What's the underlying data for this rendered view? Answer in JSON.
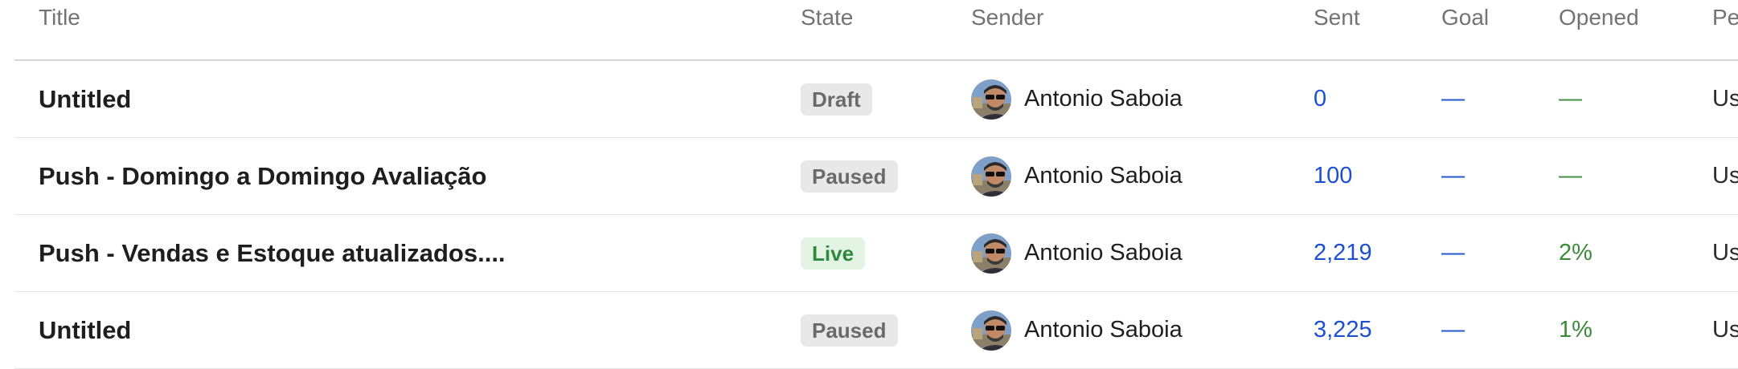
{
  "columns": {
    "title": "Title",
    "state": "State",
    "sender": "Sender",
    "sent": "Sent",
    "goal": "Goal",
    "opened": "Opened",
    "per": "Pe"
  },
  "colors": {
    "sent": "#1f4fd1",
    "opened": "#3a8a3a",
    "live_badge_bg": "#e3f4e5",
    "paused_badge_bg": "#e8e8e8"
  },
  "rows": [
    {
      "title": "Untitled",
      "state": "Draft",
      "state_kind": "draft",
      "sender": "Antonio Saboia",
      "sender_avatar": "avatar-photo-icon",
      "sent": "0",
      "goal": "—",
      "opened": "—",
      "per": "Us"
    },
    {
      "title": "Push - Domingo a Domingo Avaliação",
      "state": "Paused",
      "state_kind": "paused",
      "sender": "Antonio Saboia",
      "sender_avatar": "avatar-photo-icon",
      "sent": "100",
      "goal": "—",
      "opened": "—",
      "per": "Us"
    },
    {
      "title": "Push - Vendas e Estoque atualizados....",
      "state": "Live",
      "state_kind": "live",
      "sender": "Antonio Saboia",
      "sender_avatar": "avatar-photo-icon",
      "sent": "2,219",
      "goal": "—",
      "opened": "2%",
      "per": "Us"
    },
    {
      "title": "Untitled",
      "state": "Paused",
      "state_kind": "paused",
      "sender": "Antonio Saboia",
      "sender_avatar": "avatar-photo-icon",
      "sent": "3,225",
      "goal": "—",
      "opened": "1%",
      "per": "Us"
    }
  ]
}
